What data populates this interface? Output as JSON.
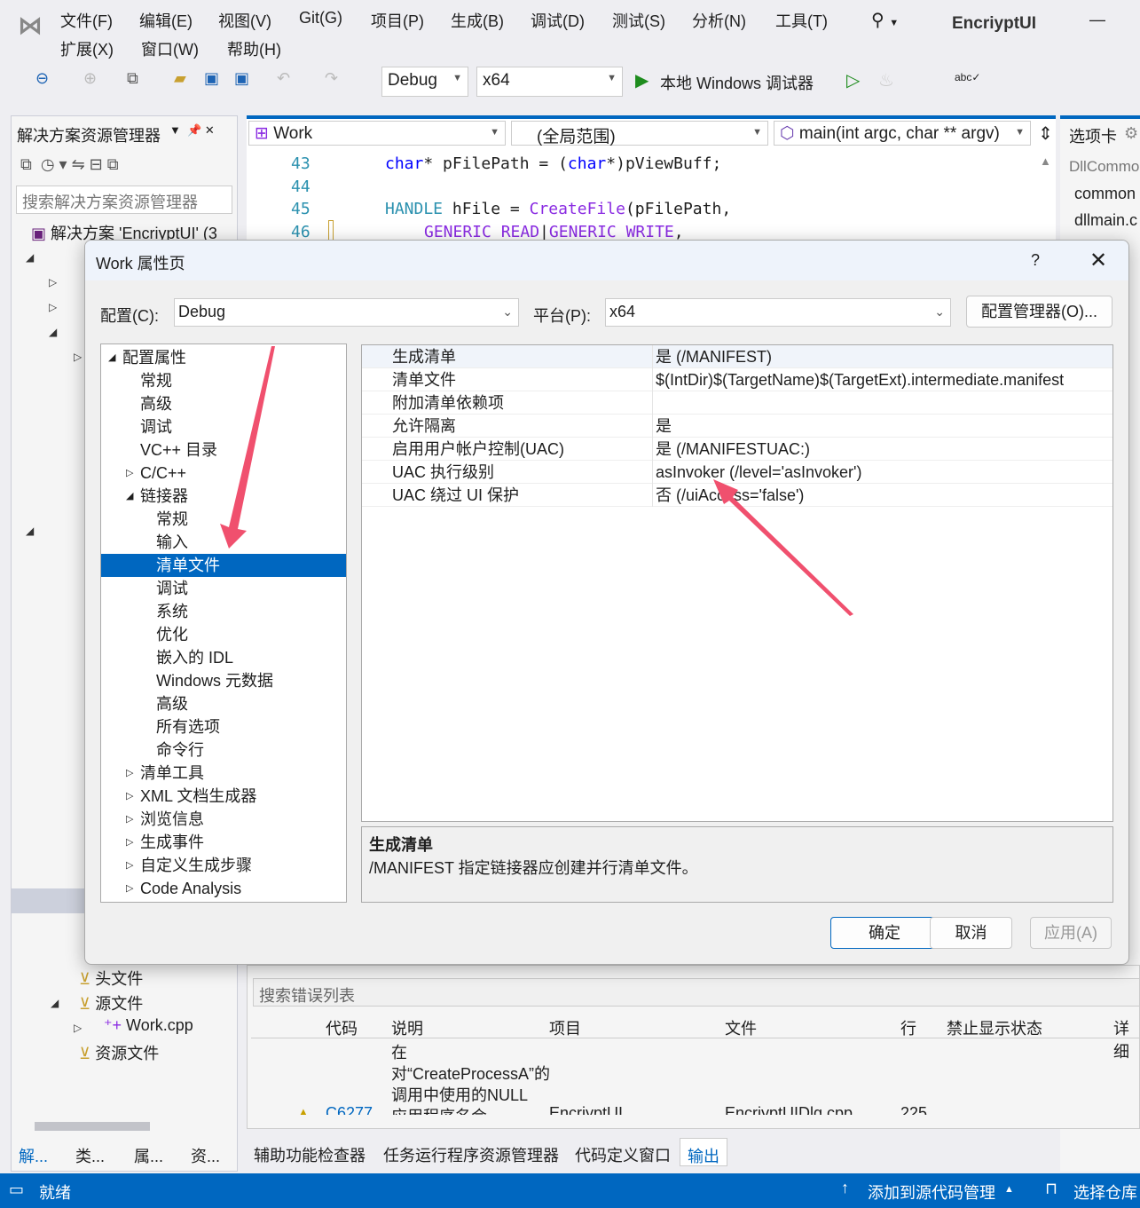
{
  "app": {
    "title": "EncriyptUI",
    "minimize": "—"
  },
  "menu": [
    "文件(F)",
    "编辑(E)",
    "视图(V)",
    "Git(G)",
    "项目(P)",
    "生成(B)",
    "调试(D)",
    "测试(S)",
    "分析(N)",
    "工具(T)",
    "扩展(X)",
    "窗口(W)",
    "帮助(H)"
  ],
  "toolbar": {
    "config": "Debug",
    "platform": "x64",
    "run_label": "本地 Windows 调试器"
  },
  "solution_explorer": {
    "title": "解决方案资源管理器",
    "search_placeholder": "搜索解决方案资源管理器",
    "solution": "解决方案 'EncriyptUI' (3",
    "items": [
      "头文件",
      "源文件",
      "Work.cpp",
      "资源文件"
    ],
    "bottom_tabs": [
      "解...",
      "类...",
      "属...",
      "资..."
    ]
  },
  "editor": {
    "project_dropdown": "Work",
    "scope_dropdown": "(全局范围)",
    "function_dropdown": "main(int argc, char ** argv)",
    "lines": [
      43,
      44,
      45,
      46
    ]
  },
  "right_panel": {
    "title": "选项卡",
    "items": [
      "DllCommo",
      "common",
      "dllmain.c"
    ]
  },
  "dialog": {
    "title": "Work 属性页",
    "help": "?",
    "config_label": "配置(C):",
    "config_value": "Debug",
    "platform_label": "平台(P):",
    "platform_value": "x64",
    "config_manager": "配置管理器(O)...",
    "tree": [
      {
        "label": "配置属性",
        "level": 0,
        "exp": "◢"
      },
      {
        "label": "常规",
        "level": 1
      },
      {
        "label": "高级",
        "level": 1
      },
      {
        "label": "调试",
        "level": 1
      },
      {
        "label": "VC++ 目录",
        "level": 1
      },
      {
        "label": "C/C++",
        "level": 1,
        "exp": "▷"
      },
      {
        "label": "链接器",
        "level": 1,
        "exp": "◢"
      },
      {
        "label": "常规",
        "level": 2
      },
      {
        "label": "输入",
        "level": 2
      },
      {
        "label": "清单文件",
        "level": 2,
        "selected": true
      },
      {
        "label": "调试",
        "level": 2
      },
      {
        "label": "系统",
        "level": 2
      },
      {
        "label": "优化",
        "level": 2
      },
      {
        "label": "嵌入的 IDL",
        "level": 2
      },
      {
        "label": "Windows 元数据",
        "level": 2
      },
      {
        "label": "高级",
        "level": 2
      },
      {
        "label": "所有选项",
        "level": 2
      },
      {
        "label": "命令行",
        "level": 2
      },
      {
        "label": "清单工具",
        "level": 1,
        "exp": "▷"
      },
      {
        "label": "XML 文档生成器",
        "level": 1,
        "exp": "▷"
      },
      {
        "label": "浏览信息",
        "level": 1,
        "exp": "▷"
      },
      {
        "label": "生成事件",
        "level": 1,
        "exp": "▷"
      },
      {
        "label": "自定义生成步骤",
        "level": 1,
        "exp": "▷"
      },
      {
        "label": "Code Analysis",
        "level": 1,
        "exp": "▷"
      }
    ],
    "properties": [
      {
        "name": "生成清单",
        "value": "是 (/MANIFEST)"
      },
      {
        "name": "清单文件",
        "value": "$(IntDir)$(TargetName)$(TargetExt).intermediate.manifest"
      },
      {
        "name": "附加清单依赖项",
        "value": ""
      },
      {
        "name": "允许隔离",
        "value": "是"
      },
      {
        "name": "启用用户帐户控制(UAC)",
        "value": "是 (/MANIFESTUAC:)"
      },
      {
        "name": "UAC 执行级别",
        "value": "asInvoker (/level='asInvoker')"
      },
      {
        "name": "UAC 绕过 UI 保护",
        "value": "否 (/uiAccess='false')"
      }
    ],
    "description_title": "生成清单",
    "description_text": "/MANIFEST 指定链接器应创建并行清单文件。",
    "ok": "确定",
    "cancel": "取消",
    "apply": "应用(A)"
  },
  "error_list": {
    "search_placeholder": "搜索错误列表",
    "columns": [
      "代码",
      "说明",
      "项目",
      "文件",
      "行",
      "禁止显示状态",
      "详细"
    ],
    "row": {
      "code": "C6277",
      "description": "在对“CreateProcessA”的调用中使用的NULL 应用程序名会",
      "project": "EncriyptUI",
      "file": "EncriyptUIDlg.cpp",
      "line": "225"
    }
  },
  "bottom_tabs": [
    "辅助功能检查器",
    "任务运行程序资源管理器",
    "代码定义窗口",
    "输出"
  ],
  "status": {
    "ready": "就绪",
    "source_control": "添加到源代码管理",
    "repo": "选择仓库"
  },
  "colors": {
    "accent": "#0067c0",
    "status_bar": "#0067c0",
    "arrow": "#f0506e"
  }
}
